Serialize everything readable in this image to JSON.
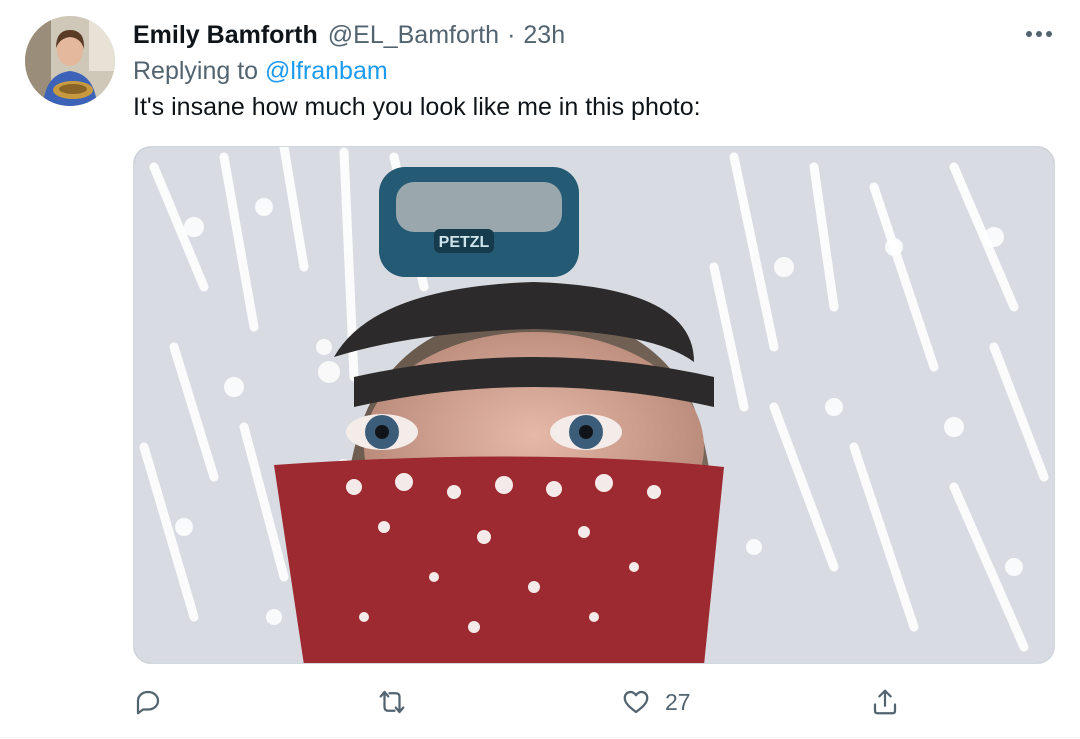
{
  "tweet": {
    "author_name": "Emily Bamforth",
    "author_handle": "@EL_Bamforth",
    "separator": "·",
    "timestamp": "23h",
    "replying_prefix": "Replying to",
    "replying_to": "@lfranbam",
    "text": "It's insane how much you look like me in this photo:",
    "media_brand_text": "PETZL"
  },
  "actions": {
    "reply_icon": "reply-icon",
    "retweet_icon": "retweet-icon",
    "like_icon": "heart-icon",
    "like_count": "27",
    "share_icon": "share-icon",
    "more_icon": "more-icon"
  },
  "colors": {
    "link": "#1d9bf0",
    "secondary_text": "#536471",
    "primary_text": "#0f1419"
  }
}
